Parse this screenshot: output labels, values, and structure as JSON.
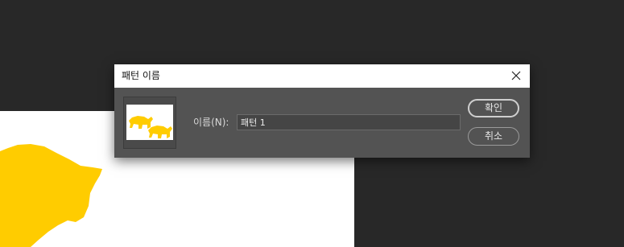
{
  "colors": {
    "app_background": "#282828",
    "dialog_background": "#535353",
    "pattern_fill": "#ffcc00"
  },
  "dialog": {
    "title": "패턴 이름",
    "name_label": "이름(N):",
    "name_value": "패턴 1",
    "ok_label": "확인",
    "cancel_label": "취소"
  },
  "icons": {
    "close": "close-icon"
  }
}
